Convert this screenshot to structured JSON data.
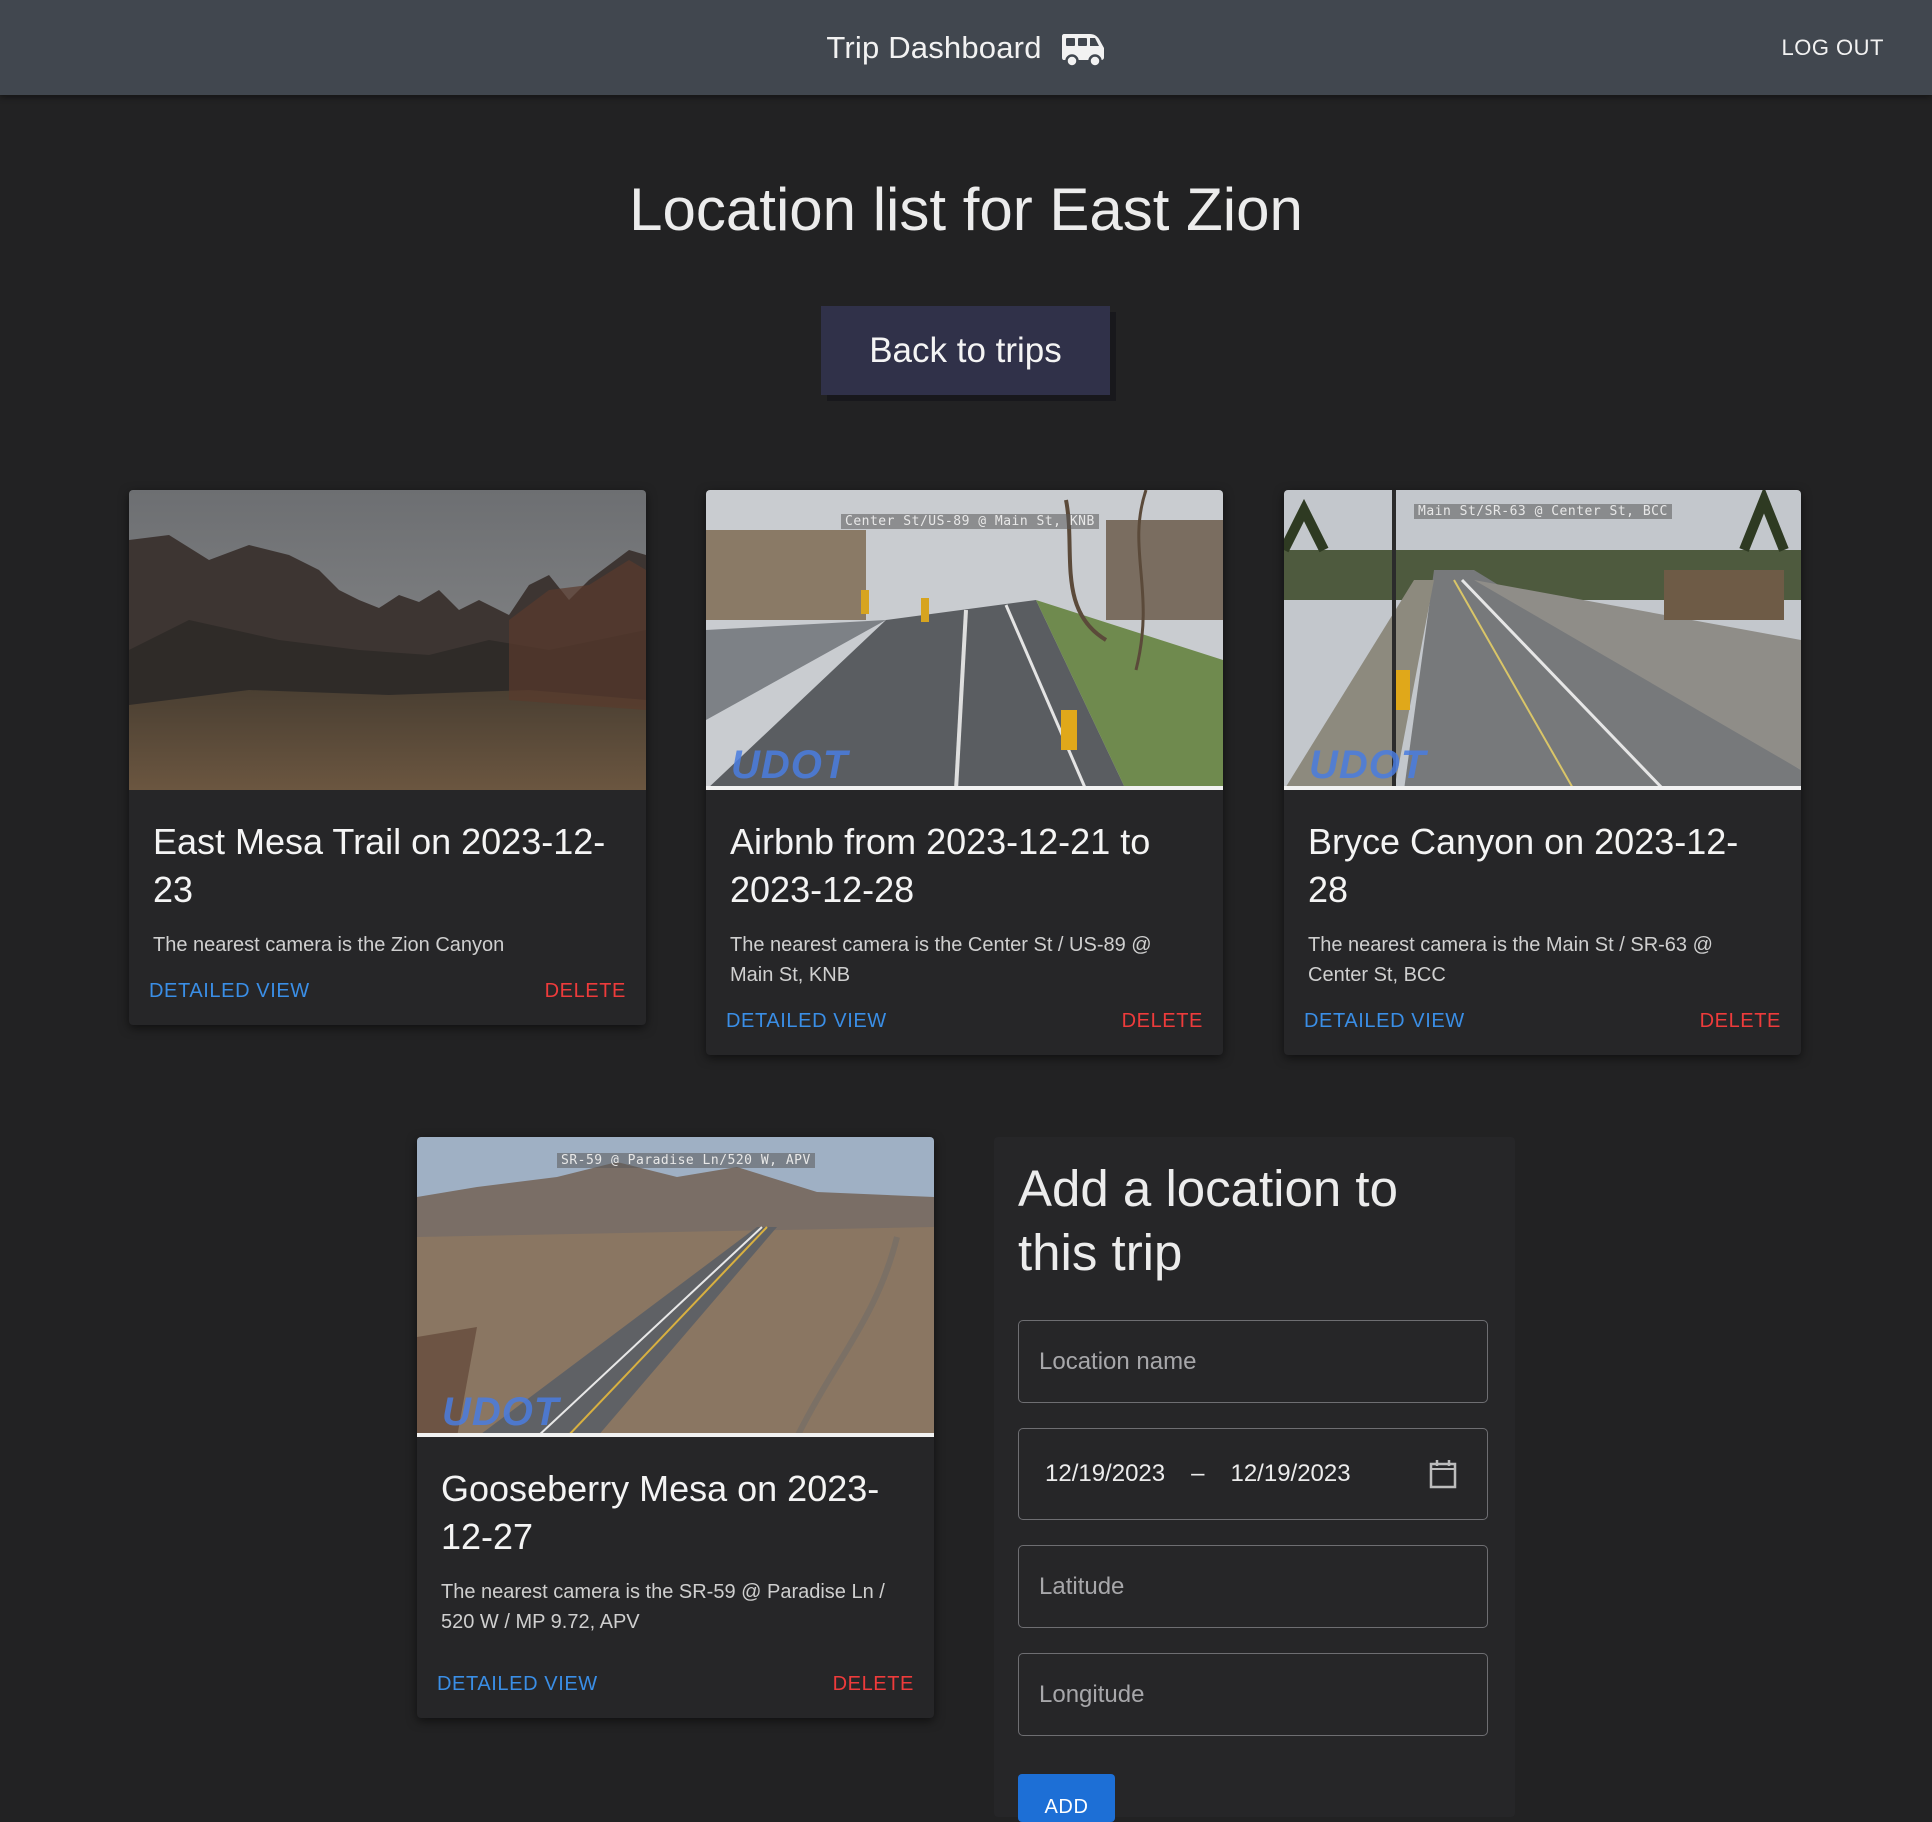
{
  "header": {
    "title": "Trip Dashboard",
    "icon": "van-icon",
    "logout_label": "LOG OUT"
  },
  "page": {
    "title": "Location list for East Zion",
    "back_label": "Back to trips"
  },
  "cards": [
    {
      "title": "East Mesa Trail on 2023-12-23",
      "description": "The nearest camera is the Zion Canyon",
      "overlay": "",
      "detail_label": "DETAILED VIEW",
      "delete_label": "DELETE"
    },
    {
      "title": "Airbnb from 2023-12-21 to 2023-12-28",
      "description": "The nearest camera is the Center St / US-89 @ Main St, KNB",
      "overlay": "Center St/US-89 @ Main St, KNB",
      "watermark": "UDOT",
      "detail_label": "DETAILED VIEW",
      "delete_label": "DELETE"
    },
    {
      "title": "Bryce Canyon on 2023-12-28",
      "description": "The nearest camera is the Main St / SR-63 @ Center St, BCC",
      "overlay": "Main St/SR-63 @ Center St, BCC",
      "watermark": "UDOT",
      "detail_label": "DETAILED VIEW",
      "delete_label": "DELETE"
    },
    {
      "title": "Gooseberry Mesa on 2023-12-27",
      "description": "The nearest camera is the SR-59 @ Paradise Ln / 520 W / MP 9.72, APV",
      "overlay": "SR-59 @ Paradise Ln/520 W, APV",
      "watermark": "UDOT",
      "detail_label": "DETAILED VIEW",
      "delete_label": "DELETE"
    }
  ],
  "form": {
    "title": "Add a location to this trip",
    "location_placeholder": "Location name",
    "date_start": "12/19/2023",
    "date_separator": "–",
    "date_end": "12/19/2023",
    "latitude_placeholder": "Latitude",
    "longitude_placeholder": "Longitude",
    "add_label": "ADD"
  },
  "colors": {
    "appbar": "#41474f",
    "background": "#222223",
    "card": "#262628",
    "primary": "#3a8ee6",
    "danger": "#ee3b3b",
    "back_button": "#303149"
  }
}
